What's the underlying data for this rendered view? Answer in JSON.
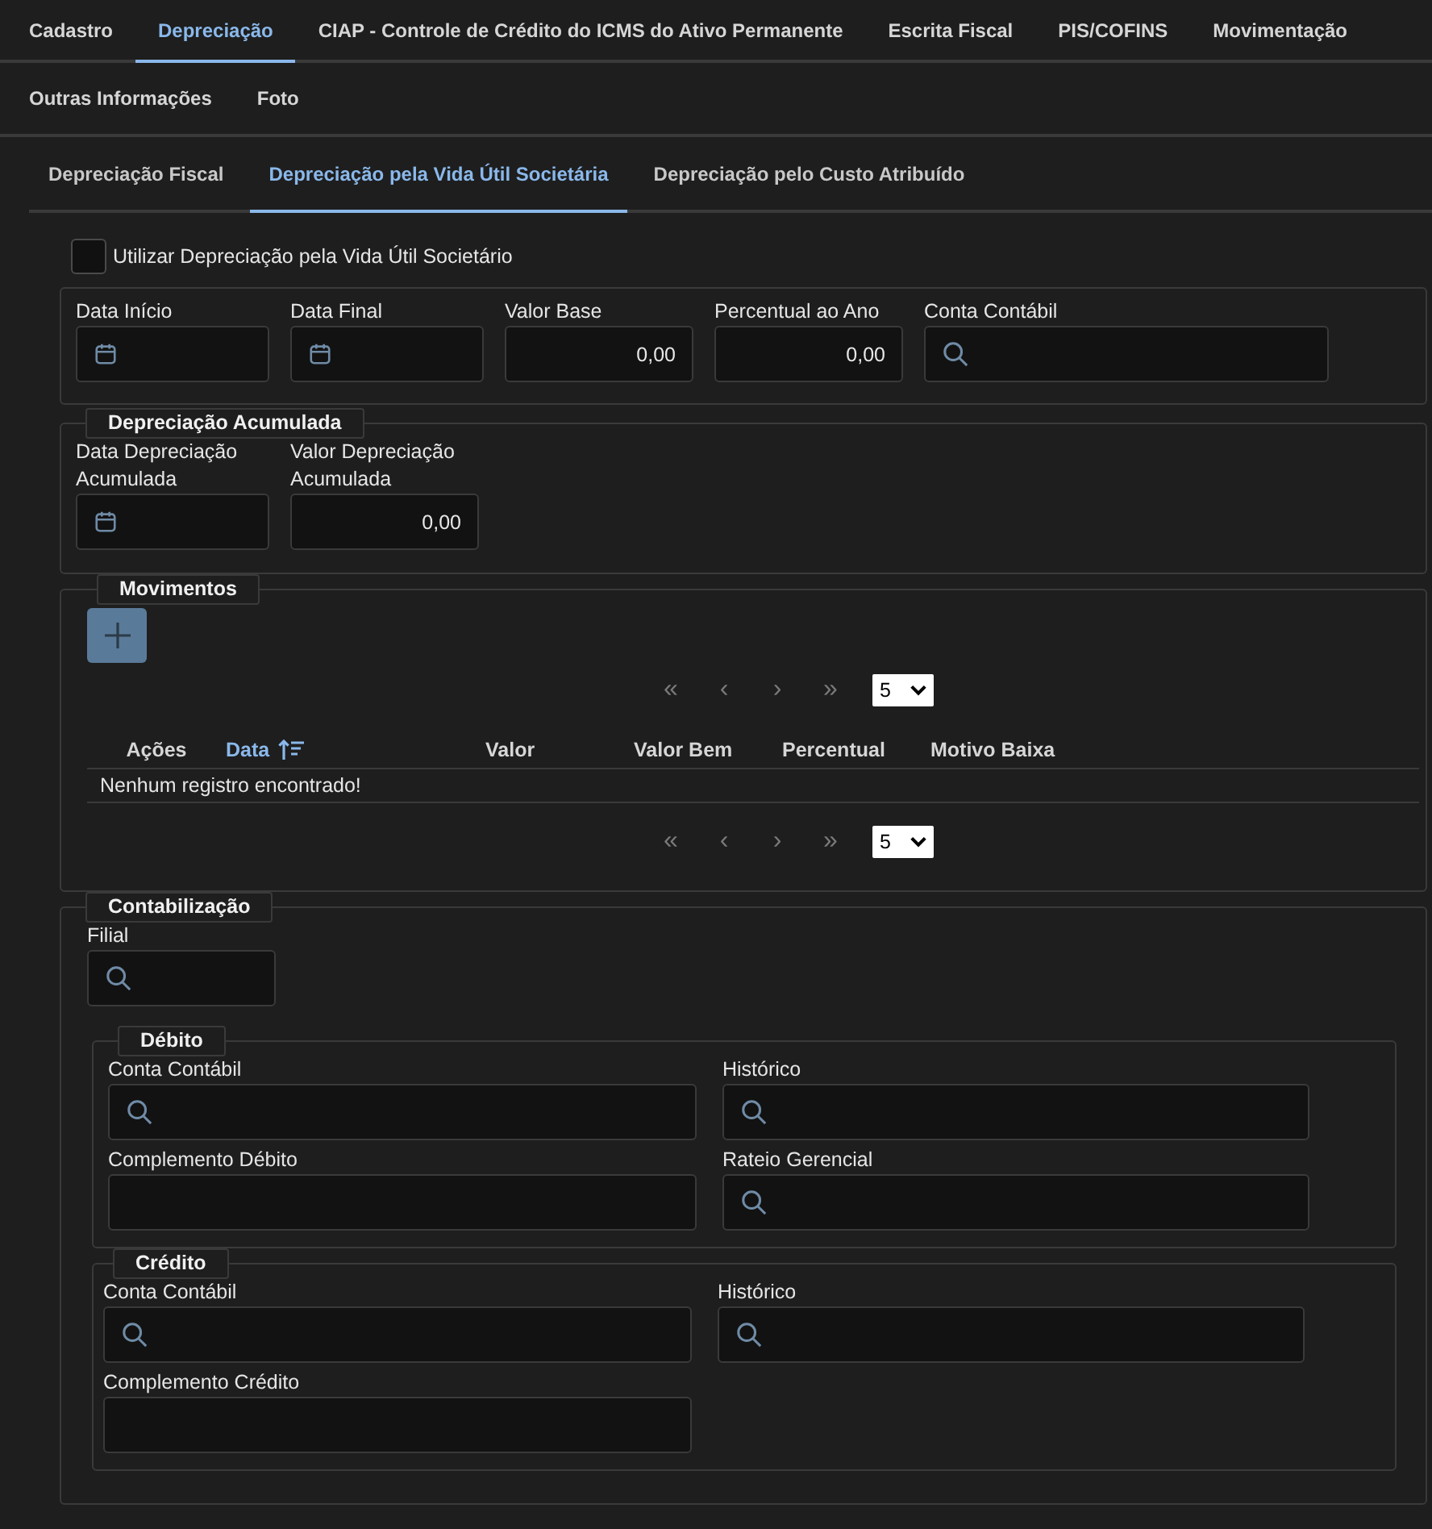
{
  "tab_rows": [
    [
      {
        "label": "Cadastro",
        "selected": false
      },
      {
        "label": "Depreciação",
        "selected": true
      },
      {
        "label": "CIAP - Controle de Crédito do ICMS do Ativo Permanente",
        "selected": false
      },
      {
        "label": "Escrita Fiscal",
        "selected": false
      },
      {
        "label": "PIS/COFINS",
        "selected": false
      },
      {
        "label": "Movimentação",
        "selected": false
      }
    ],
    [
      {
        "label": "Outras Informações",
        "selected": false
      },
      {
        "label": "Foto",
        "selected": false
      }
    ]
  ],
  "subtabs": [
    {
      "label": "Depreciação Fiscal",
      "selected": false
    },
    {
      "label": "Depreciação pela Vida Útil Societária",
      "selected": true
    },
    {
      "label": "Depreciação pelo Custo Atribuído",
      "selected": false
    }
  ],
  "use_checkbox": {
    "label": "Utilizar Depreciação pela Vida Útil Societário",
    "checked": false
  },
  "period": {
    "fields": [
      {
        "label": "Data Início",
        "kind": "date"
      },
      {
        "label": "Data Final",
        "kind": "date"
      },
      {
        "label": "Valor Base",
        "kind": "number",
        "value": "0,00"
      },
      {
        "label": "Percentual ao Ano",
        "kind": "number",
        "value": "0,00"
      },
      {
        "label": "Conta Contábil",
        "kind": "search"
      }
    ]
  },
  "accumulated": {
    "legend": "Depreciação Acumulada",
    "fields": [
      {
        "label": "Data Depreciação Acumulada",
        "kind": "date"
      },
      {
        "label": "Valor Depreciação Acumulada",
        "kind": "number",
        "value": "0,00"
      }
    ]
  },
  "movements": {
    "legend": "Movimentos",
    "top_pager": {
      "buttons": [
        "«",
        "‹",
        "›",
        "»"
      ],
      "page_size": "5"
    },
    "columns": [
      {
        "label": "Ações",
        "sorted": false
      },
      {
        "label": "Data",
        "sorted": true
      },
      {
        "label": "Valor",
        "sorted": false
      },
      {
        "label": "Valor Bem",
        "sorted": false
      },
      {
        "label": "Percentual",
        "sorted": false
      },
      {
        "label": "Motivo Baixa",
        "sorted": false
      }
    ],
    "empty_message": "Nenhum registro encontrado!",
    "bottom_pager": {
      "buttons": [
        "«",
        "‹",
        "›",
        "»"
      ],
      "page_size": "5"
    }
  },
  "accounting": {
    "legend": "Contabilização",
    "fields": [
      {
        "label": "Filial",
        "kind": "search"
      }
    ],
    "groups": [
      {
        "legend": "Débito",
        "fields": [
          {
            "label": "Conta Contábil",
            "kind": "search"
          },
          {
            "label": "Histórico",
            "kind": "search"
          },
          {
            "label": "Complemento Débito",
            "kind": "text"
          },
          {
            "label": "Rateio Gerencial",
            "kind": "search"
          }
        ]
      },
      {
        "legend": "Crédito",
        "fields": [
          {
            "label": "Conta Contábil",
            "kind": "search"
          },
          {
            "label": "Histórico",
            "kind": "search"
          },
          {
            "label": "Complemento Crédito",
            "kind": "text"
          }
        ]
      }
    ]
  }
}
